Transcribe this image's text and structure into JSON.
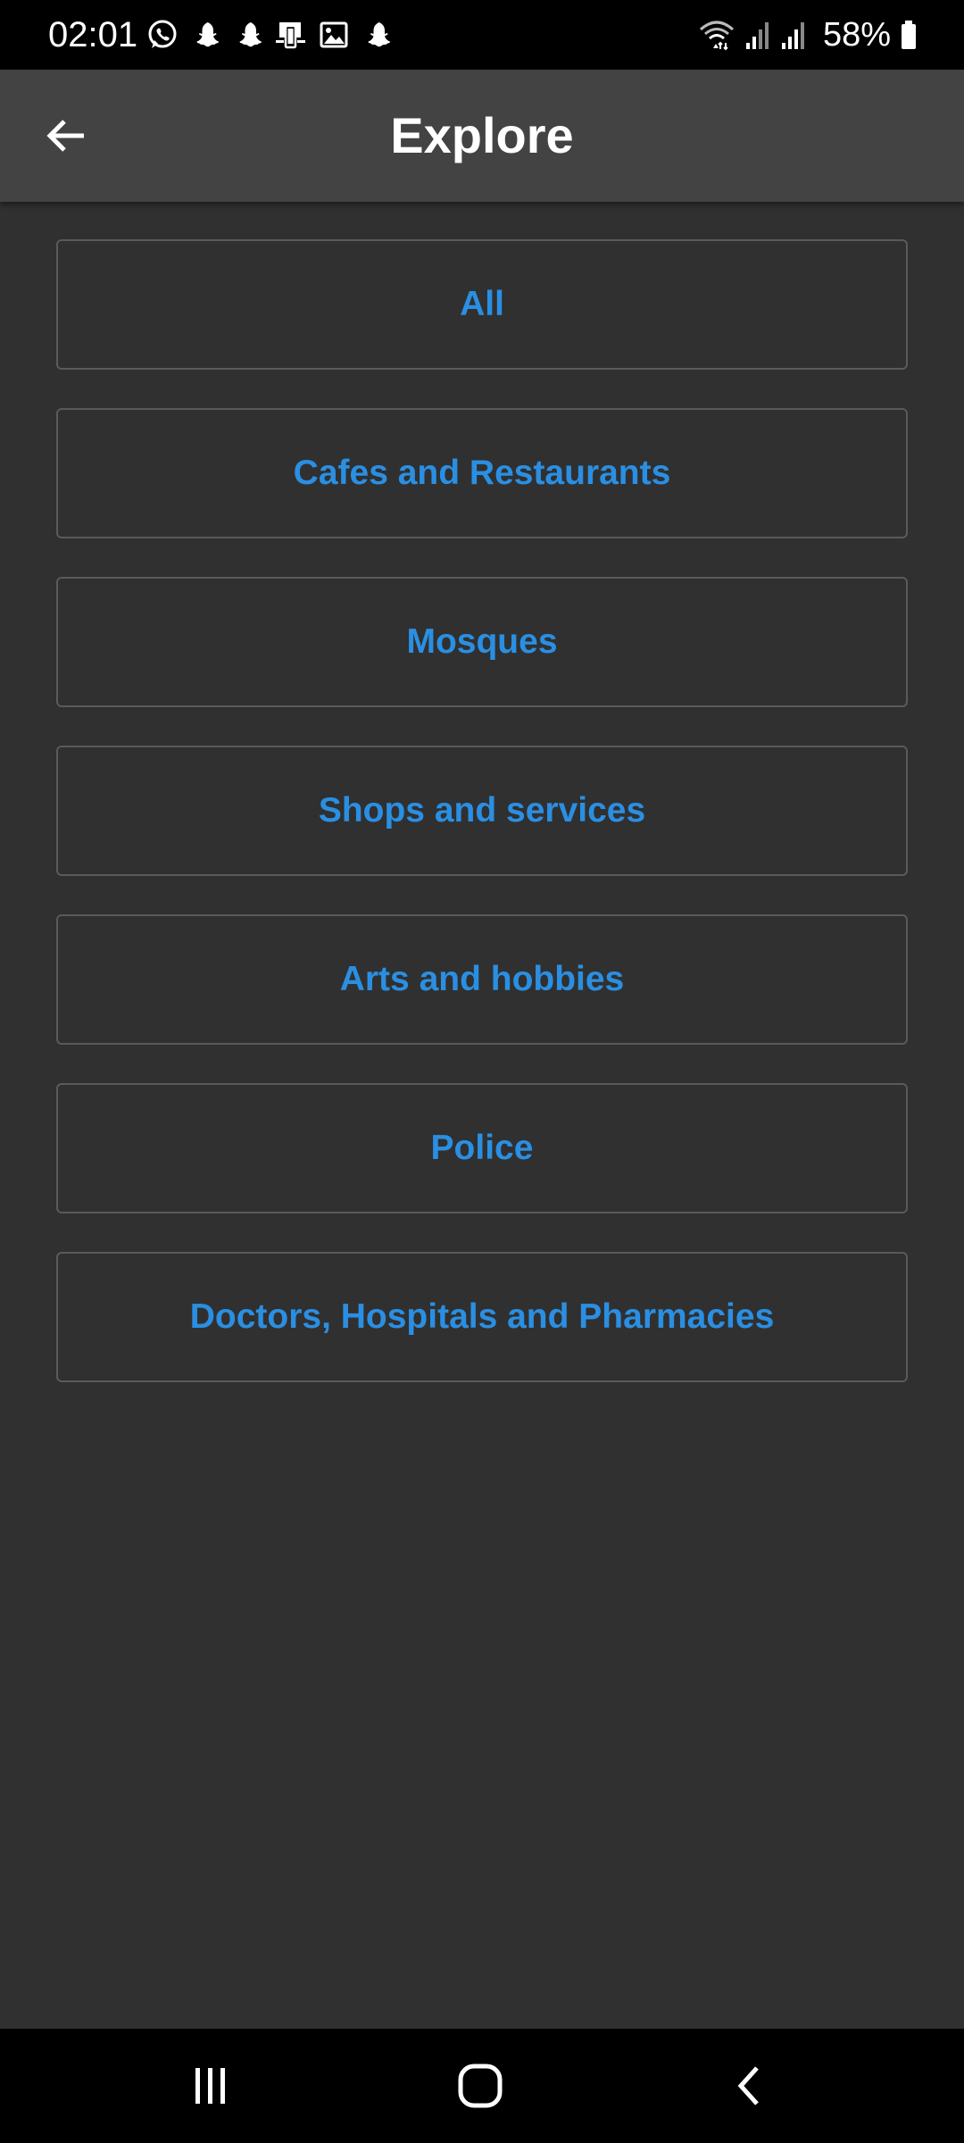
{
  "status_bar": {
    "time": "02:01",
    "battery": "58%",
    "notification_icons": [
      "whatsapp-icon",
      "snapchat-icon",
      "snapchat-icon",
      "screen-mirror-icon",
      "gallery-icon",
      "snapchat-icon"
    ],
    "system_icons": [
      "wifi-icon",
      "signal-icon",
      "signal-icon",
      "battery-icon"
    ]
  },
  "app_bar": {
    "title": "Explore",
    "back_icon": "arrow-left-icon"
  },
  "categories": [
    {
      "label": "All"
    },
    {
      "label": "Cafes and Restaurants"
    },
    {
      "label": "Mosques"
    },
    {
      "label": "Shops and services"
    },
    {
      "label": "Arts and hobbies"
    },
    {
      "label": "Police"
    },
    {
      "label": "Doctors, Hospitals and Pharmacies"
    }
  ],
  "nav_bar": {
    "recents_icon": "recents-icon",
    "home_icon": "home-icon",
    "back_icon": "back-chevron-icon"
  },
  "colors": {
    "background": "#303030",
    "app_bar": "#434343",
    "accent_text": "#2a8fe3",
    "button_border": "#5a5a5a",
    "system_bars": "#000000"
  }
}
